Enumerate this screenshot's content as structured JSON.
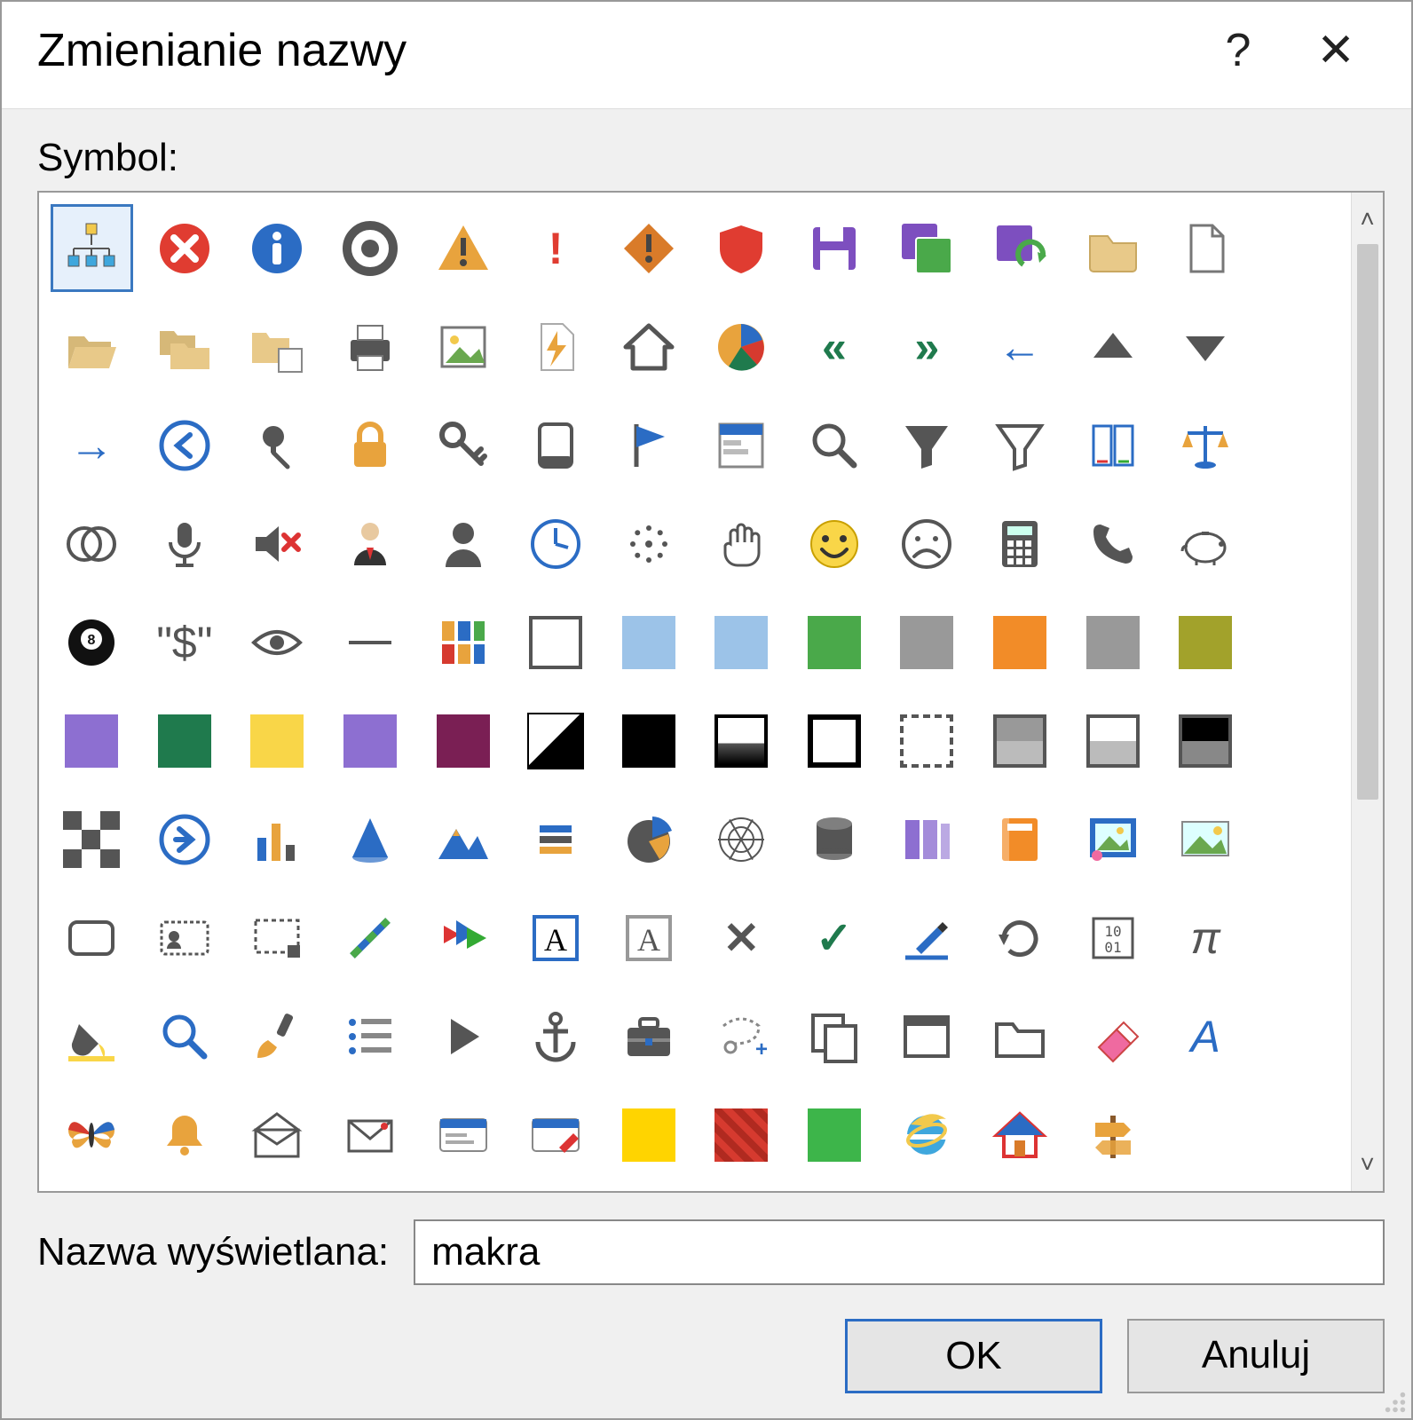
{
  "dialog": {
    "title": "Zmienianie nazwy",
    "help_symbol": "?",
    "close_symbol": "✕"
  },
  "symbol_section": {
    "label": "Symbol:"
  },
  "display_name": {
    "label": "Nazwa wyświetlana:",
    "value": "makra"
  },
  "buttons": {
    "ok": "OK",
    "cancel": "Anuluj"
  },
  "colors": {
    "red": "#e03c31",
    "blue": "#2b6cc4",
    "dkgray": "#555555",
    "orange": "#e8a33d",
    "darkorange": "#d97b29",
    "folder": "#e8c989",
    "purple": "#7d4fbf",
    "green": "#4aa94a",
    "dkgreen": "#1f7a4d",
    "yellow": "#f9d648",
    "olive": "#a2a22b",
    "magenta": "#7a1f54",
    "violet": "#8d6fd1",
    "lightblue": "#9cc3e8",
    "black": "#000000",
    "white": "#ffffff",
    "gray": "#999999",
    "brightorange": "#f28c28",
    "pink": "#ef6aa0",
    "redhatch": "#d63a2f",
    "brightyellow": "#ffd400",
    "brightgreen": "#3db54a",
    "iepurple": "#5b2e91"
  },
  "grid": {
    "selected_index": 0,
    "icons": [
      {
        "name": "hierarchy-icon",
        "type": "svg-hierarchy"
      },
      {
        "name": "error-circle-icon",
        "type": "circle-x",
        "fill": "red"
      },
      {
        "name": "info-circle-icon",
        "type": "circle-i",
        "fill": "blue"
      },
      {
        "name": "record-circle-icon",
        "type": "ring",
        "fill": "dkgray"
      },
      {
        "name": "warning-triangle-icon",
        "type": "tri-bang",
        "fill": "orange"
      },
      {
        "name": "exclamation-icon",
        "type": "glyph",
        "glyph": "!",
        "color": "red",
        "bold": true
      },
      {
        "name": "warning-diamond-icon",
        "type": "diamond-bang",
        "fill": "darkorange"
      },
      {
        "name": "shield-icon",
        "type": "shield",
        "fill": "red"
      },
      {
        "name": "save-icon",
        "type": "floppy",
        "fill": "purple"
      },
      {
        "name": "save-all-icon",
        "type": "floppy-stack",
        "fill": "purple"
      },
      {
        "name": "save-refresh-icon",
        "type": "floppy-arrow",
        "fill": "purple"
      },
      {
        "name": "folder-icon",
        "type": "folder",
        "fill": "folder"
      },
      {
        "name": "file-icon",
        "type": "file-outline"
      },
      {
        "name": "blank-1",
        "type": "blank"
      },
      {
        "name": "folder-open-icon",
        "type": "folder-open",
        "fill": "folder"
      },
      {
        "name": "folders-icon",
        "type": "folders",
        "fill": "folder"
      },
      {
        "name": "folder-doc-icon",
        "type": "folder-doc",
        "fill": "folder"
      },
      {
        "name": "printer-icon",
        "type": "printer",
        "fill": "dkgray"
      },
      {
        "name": "image-icon",
        "type": "image-outline"
      },
      {
        "name": "flash-doc-icon",
        "type": "flash-doc",
        "fill": "orange"
      },
      {
        "name": "home-icon",
        "type": "home",
        "fill": "dkgray"
      },
      {
        "name": "pie-chart-icon",
        "type": "pie-multi"
      },
      {
        "name": "double-left-icon",
        "type": "glyph",
        "glyph": "«",
        "color": "dkgreen",
        "bold": true
      },
      {
        "name": "double-right-icon",
        "type": "glyph",
        "glyph": "»",
        "color": "dkgreen",
        "bold": true
      },
      {
        "name": "arrow-left-icon",
        "type": "glyph",
        "glyph": "←",
        "color": "blue",
        "bold": true
      },
      {
        "name": "triangle-up-icon",
        "type": "tri-up",
        "fill": "dkgray"
      },
      {
        "name": "triangle-down-icon",
        "type": "tri-down",
        "fill": "dkgray"
      },
      {
        "name": "blank-2",
        "type": "blank"
      },
      {
        "name": "arrow-right-icon",
        "type": "glyph",
        "glyph": "→",
        "color": "blue",
        "bold": true
      },
      {
        "name": "back-circle-icon",
        "type": "circle-arrow-left",
        "fill": "blue"
      },
      {
        "name": "pin-icon",
        "type": "pin",
        "fill": "dkgray"
      },
      {
        "name": "lock-icon",
        "type": "lock",
        "fill": "orange"
      },
      {
        "name": "key-icon",
        "type": "key",
        "fill": "dkgray"
      },
      {
        "name": "device-icon",
        "type": "device",
        "fill": "dkgray"
      },
      {
        "name": "flag-icon",
        "type": "flag",
        "fill": "blue"
      },
      {
        "name": "properties-icon",
        "type": "properties",
        "fill": "blue"
      },
      {
        "name": "search-icon",
        "type": "magnifier",
        "fill": "dkgray"
      },
      {
        "name": "filter-filled-icon",
        "type": "funnel",
        "fill": "dkgray"
      },
      {
        "name": "filter-outline-icon",
        "type": "funnel-outline",
        "fill": "dkgray"
      },
      {
        "name": "book-icon",
        "type": "book",
        "fill": "blue"
      },
      {
        "name": "scales-icon",
        "type": "scales",
        "fill": "orange",
        "line": "blue"
      },
      {
        "name": "blank-3",
        "type": "blank"
      },
      {
        "name": "venn-icon",
        "type": "venn",
        "fill": "dkgray"
      },
      {
        "name": "microphone-icon",
        "type": "mic",
        "fill": "dkgray"
      },
      {
        "name": "mute-icon",
        "type": "speaker-x",
        "fill": "dkgray"
      },
      {
        "name": "user-suit-icon",
        "type": "user-suit"
      },
      {
        "name": "user-icon",
        "type": "user",
        "fill": "dkgray"
      },
      {
        "name": "clock-icon",
        "type": "clock",
        "fill": "blue"
      },
      {
        "name": "scatter-icon",
        "type": "scatter",
        "fill": "dkgray"
      },
      {
        "name": "hand-icon",
        "type": "hand",
        "fill": "dkgray"
      },
      {
        "name": "smiley-icon",
        "type": "smiley",
        "fill": "yellow"
      },
      {
        "name": "frown-icon",
        "type": "frown",
        "fill": "dkgray"
      },
      {
        "name": "calculator-icon",
        "type": "calculator",
        "fill": "dkgray"
      },
      {
        "name": "phone-icon",
        "type": "phone",
        "fill": "dkgray"
      },
      {
        "name": "piggybank-icon",
        "type": "piggy",
        "fill": "dkgray"
      },
      {
        "name": "blank-4",
        "type": "blank"
      },
      {
        "name": "eightball-icon",
        "type": "eightball"
      },
      {
        "name": "currency-icon",
        "type": "glyph",
        "glyph": "\"$\"",
        "color": "dkgray"
      },
      {
        "name": "eye-icon",
        "type": "eye",
        "fill": "dkgray"
      },
      {
        "name": "minus-icon",
        "type": "hline",
        "fill": "dkgray"
      },
      {
        "name": "palette-tiles-icon",
        "type": "tiles-multi"
      },
      {
        "name": "square-white",
        "type": "sq-outline"
      },
      {
        "name": "square-blue",
        "type": "sq",
        "fill": "lightblue"
      },
      {
        "name": "square-lightblue",
        "type": "sq",
        "fill": "lightblue"
      },
      {
        "name": "square-green",
        "type": "sq",
        "fill": "green"
      },
      {
        "name": "square-gray",
        "type": "sq",
        "fill": "gray"
      },
      {
        "name": "square-orange",
        "type": "sq",
        "fill": "brightorange"
      },
      {
        "name": "square-gray2",
        "type": "sq",
        "fill": "gray"
      },
      {
        "name": "square-olive",
        "type": "sq",
        "fill": "olive"
      },
      {
        "name": "blank-5",
        "type": "blank"
      },
      {
        "name": "square-violet",
        "type": "sq",
        "fill": "violet"
      },
      {
        "name": "square-darkgreen",
        "type": "sq",
        "fill": "dkgreen"
      },
      {
        "name": "square-yellow",
        "type": "sq",
        "fill": "yellow"
      },
      {
        "name": "square-purple",
        "type": "sq",
        "fill": "violet"
      },
      {
        "name": "square-magenta",
        "type": "sq",
        "fill": "magenta"
      },
      {
        "name": "halfsquare-icon",
        "type": "half-diag"
      },
      {
        "name": "square-black",
        "type": "sq",
        "fill": "black"
      },
      {
        "name": "gradient-bottom",
        "type": "grad-bottom"
      },
      {
        "name": "square-outline2",
        "type": "sq-outline-thick"
      },
      {
        "name": "square-dotted",
        "type": "sq-dotted"
      },
      {
        "name": "row-split-gray",
        "type": "row-split",
        "top": "gray"
      },
      {
        "name": "row-split-white",
        "type": "row-split",
        "top": "white"
      },
      {
        "name": "row-split-black",
        "type": "row-split",
        "top": "black"
      },
      {
        "name": "blank-6",
        "type": "blank"
      },
      {
        "name": "checker-icon",
        "type": "checker"
      },
      {
        "name": "forward-circle-icon",
        "type": "circle-arrow-right",
        "fill": "blue"
      },
      {
        "name": "bar-chart-icon",
        "type": "bars"
      },
      {
        "name": "cone-icon",
        "type": "cone",
        "fill": "blue"
      },
      {
        "name": "mountains-icon",
        "type": "mountains",
        "fill": "blue"
      },
      {
        "name": "stacked-bars-icon",
        "type": "stacked-bars"
      },
      {
        "name": "pie2-icon",
        "type": "pie2"
      },
      {
        "name": "spiderweb-icon",
        "type": "web",
        "fill": "dkgray"
      },
      {
        "name": "cylinder-icon",
        "type": "cylinder",
        "fill": "dkgray"
      },
      {
        "name": "books-purple-icon",
        "type": "books",
        "fill": "violet"
      },
      {
        "name": "book-orange-icon",
        "type": "book-fill",
        "fill": "brightorange"
      },
      {
        "name": "picture-icon",
        "type": "picture",
        "fill": "blue"
      },
      {
        "name": "landscape-icon",
        "type": "landscape"
      },
      {
        "name": "blank-7",
        "type": "blank"
      },
      {
        "name": "rounded-rect-icon",
        "type": "rrect",
        "fill": "dkgray"
      },
      {
        "name": "id-card-icon",
        "type": "idcard",
        "fill": "dkgray"
      },
      {
        "name": "marquee-icon",
        "type": "marquee",
        "fill": "dkgray"
      },
      {
        "name": "slash-icon",
        "type": "slash"
      },
      {
        "name": "play-arrows-icon",
        "type": "play-arrows"
      },
      {
        "name": "letter-a-box-icon",
        "type": "a-box",
        "fill": "blue"
      },
      {
        "name": "letter-a-grey-icon",
        "type": "a-box",
        "fill": "gray"
      },
      {
        "name": "x-icon",
        "type": "glyph",
        "glyph": "✕",
        "color": "dkgray",
        "bold": true
      },
      {
        "name": "check-icon",
        "type": "glyph",
        "glyph": "✓",
        "color": "dkgreen",
        "bold": true
      },
      {
        "name": "edit-underline-icon",
        "type": "pen-line",
        "fill": "blue"
      },
      {
        "name": "refresh-icon",
        "type": "refresh",
        "fill": "dkgray"
      },
      {
        "name": "binary-icon",
        "type": "binary",
        "fill": "dkgray"
      },
      {
        "name": "pi-icon",
        "type": "glyph",
        "glyph": "π",
        "color": "dkgray",
        "italic": true
      },
      {
        "name": "blank-8",
        "type": "blank"
      },
      {
        "name": "paint-bucket-icon",
        "type": "bucket",
        "fill": "yellow"
      },
      {
        "name": "zoom-icon",
        "type": "magnifier",
        "fill": "blue"
      },
      {
        "name": "brush-icon",
        "type": "brush",
        "fill": "orange"
      },
      {
        "name": "list-icon",
        "type": "list",
        "fill": "blue"
      },
      {
        "name": "play-icon",
        "type": "tri-right",
        "fill": "dkgray"
      },
      {
        "name": "anchor-icon",
        "type": "anchor",
        "fill": "dkgray"
      },
      {
        "name": "briefcase-icon",
        "type": "briefcase",
        "fill": "dkgray"
      },
      {
        "name": "lasso-add-icon",
        "type": "lasso",
        "fill": "blue"
      },
      {
        "name": "copy-icon",
        "type": "copy",
        "fill": "dkgray"
      },
      {
        "name": "window-icon",
        "type": "window",
        "fill": "dkgray"
      },
      {
        "name": "folder-outline-icon",
        "type": "folder-outline",
        "fill": "dkgray"
      },
      {
        "name": "eraser-icon",
        "type": "eraser",
        "fill": "pink"
      },
      {
        "name": "italic-a-icon",
        "type": "glyph",
        "glyph": "A",
        "color": "blue",
        "italic": true
      },
      {
        "name": "blank-9",
        "type": "blank"
      },
      {
        "name": "butterfly-icon",
        "type": "butterfly"
      },
      {
        "name": "bell-icon",
        "type": "bell",
        "fill": "orange"
      },
      {
        "name": "mail-open-icon",
        "type": "mail-open",
        "fill": "dkgray"
      },
      {
        "name": "mail-icon",
        "type": "mail",
        "fill": "dkgray"
      },
      {
        "name": "card-blue-icon",
        "type": "card",
        "fill": "blue"
      },
      {
        "name": "card-edit-icon",
        "type": "card-pen",
        "fill": "blue"
      },
      {
        "name": "square-yellow2",
        "type": "sq",
        "fill": "brightyellow"
      },
      {
        "name": "square-redhatch",
        "type": "hatch",
        "fill": "redhatch"
      },
      {
        "name": "square-green2",
        "type": "sq",
        "fill": "brightgreen"
      },
      {
        "name": "ie-icon",
        "type": "ie"
      },
      {
        "name": "home-color-icon",
        "type": "home-color"
      },
      {
        "name": "signpost-icon",
        "type": "signpost",
        "fill": "orange"
      },
      {
        "name": "blank-10",
        "type": "blank"
      },
      {
        "name": "blank-11",
        "type": "blank"
      }
    ]
  }
}
